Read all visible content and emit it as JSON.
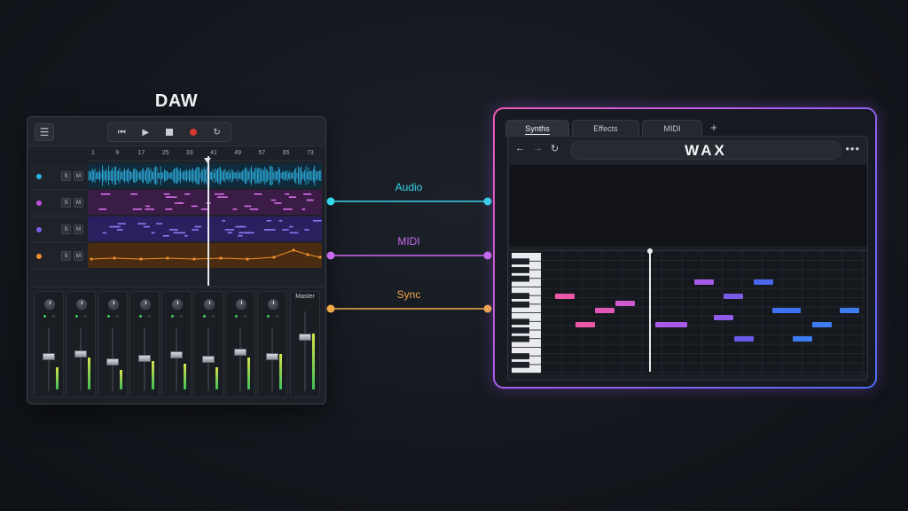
{
  "daw": {
    "title": "DAW",
    "menu_icon": "menu-icon",
    "transport": [
      "skip-back-icon",
      "play-icon",
      "stop-icon",
      "record-icon",
      "loop-icon"
    ],
    "ruler": [
      "1",
      "9",
      "17",
      "25",
      "33",
      "41",
      "49",
      "57",
      "65",
      "73"
    ],
    "tracks": [
      {
        "color": "#27b7e8",
        "solo": "S",
        "mute": "M",
        "kind": "audio"
      },
      {
        "color": "#c24fe0",
        "solo": "S",
        "mute": "M",
        "kind": "midi"
      },
      {
        "color": "#7a5ce8",
        "solo": "S",
        "mute": "M",
        "kind": "midi"
      },
      {
        "color": "#f0902a",
        "solo": "S",
        "mute": "M",
        "kind": "automation"
      }
    ],
    "mixer": {
      "channel_count": 8,
      "fader_levels": [
        0.55,
        0.6,
        0.45,
        0.52,
        0.58,
        0.5,
        0.62,
        0.55
      ],
      "meter_levels": [
        0.35,
        0.5,
        0.3,
        0.45,
        0.4,
        0.35,
        0.5,
        0.55
      ],
      "master_label": "Master",
      "master_level": 0.7
    }
  },
  "connections": [
    {
      "label": "Audio",
      "color": "#35d6e8"
    },
    {
      "label": "MIDI",
      "color": "#c96af0"
    },
    {
      "label": "Sync",
      "color": "#f2a94a"
    }
  ],
  "wax": {
    "tabs": [
      {
        "label": "Synths",
        "active": true
      },
      {
        "label": "Effects",
        "active": false
      },
      {
        "label": "MIDI",
        "active": false
      }
    ],
    "add_tab_icon": "plus-icon",
    "nav_icons": [
      "back-arrow-icon",
      "forward-arrow-icon",
      "reload-icon"
    ],
    "brand": "WAX",
    "more_icon": "more-dots-icon",
    "gradient": [
      "#f2549e",
      "#b05cf0",
      "#3d7cf0"
    ]
  }
}
